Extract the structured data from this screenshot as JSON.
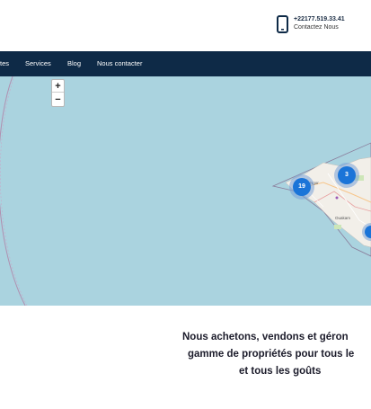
{
  "header": {
    "phone": "+22177.519.33.41",
    "contact_label": "Contactez Nous"
  },
  "nav": {
    "items": [
      "tes",
      "Services",
      "Blog",
      "Nous contacter"
    ]
  },
  "map": {
    "zoom_in": "+",
    "zoom_out": "−",
    "place_labels": [
      "Ngor",
      "Ouakam"
    ],
    "clusters": [
      {
        "count": "19"
      },
      {
        "count": "3"
      }
    ]
  },
  "tagline": {
    "line1": "Nous achetons, vendons et géron",
    "line2": "gamme de propriétés pour tous le",
    "line3": "et tous les goûts"
  },
  "colors": {
    "nav_bg": "#0e2a47",
    "sea": "#aad3df",
    "cluster": "#1a74d8"
  }
}
